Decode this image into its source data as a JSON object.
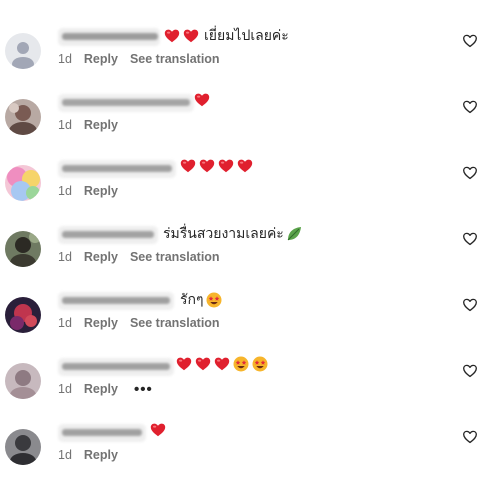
{
  "comments": [
    {
      "username": "blurred-username-1",
      "emojis_before": [
        "heart",
        "heart"
      ],
      "text": "เยี่ยมไปเลยค่ะ",
      "emojis_after": [],
      "time": "1d",
      "reply": "Reply",
      "translate": "See translation",
      "more": ""
    },
    {
      "username": "blurred-username-2",
      "emojis_before": [
        "heart"
      ],
      "text": "",
      "emojis_after": [],
      "time": "1d",
      "reply": "Reply",
      "translate": "",
      "more": ""
    },
    {
      "username": "blurred-username-3",
      "emojis_before": [
        "heart",
        "heart",
        "heart",
        "heart"
      ],
      "text": "",
      "emojis_after": [],
      "time": "1d",
      "reply": "Reply",
      "translate": "",
      "more": ""
    },
    {
      "username": "blurred-username-4",
      "emojis_before": [],
      "text": "ร่มรื่นสวยงามเลยค่ะ",
      "emojis_after": [
        "leaf"
      ],
      "time": "1d",
      "reply": "Reply",
      "translate": "See translation",
      "more": ""
    },
    {
      "username": "blurred-username-5",
      "emojis_before": [],
      "text": "รักๆ",
      "emojis_after": [
        "star-struck"
      ],
      "time": "1d",
      "reply": "Reply",
      "translate": "See translation",
      "more": ""
    },
    {
      "username": "blurred-username-6",
      "emojis_before": [
        "heart",
        "heart",
        "heart",
        "star-struck",
        "star-struck"
      ],
      "text": "",
      "emojis_after": [],
      "time": "1d",
      "reply": "Reply",
      "translate": "",
      "more": "•••"
    },
    {
      "username": "blurred-username-7",
      "emojis_before": [
        "heart"
      ],
      "text": "",
      "emojis_after": [],
      "time": "1d",
      "reply": "Reply",
      "translate": "",
      "more": ""
    }
  ],
  "colors": {
    "text": "#262626",
    "secondary": "#737373",
    "heart": "#e0202e",
    "icon": "#262626",
    "username_blur": "#9a9a9a"
  },
  "icons": {
    "like": "heart-outline-icon",
    "heart": "red-heart-emoji",
    "leaf": "leaf-emoji",
    "star-struck": "star-struck-emoji"
  }
}
